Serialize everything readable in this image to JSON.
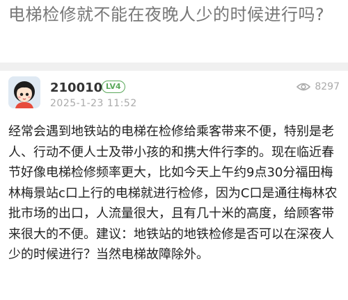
{
  "post": {
    "title": "电梯检修就不能在夜晚人少的时候进行吗?",
    "author": {
      "name": "210010",
      "level": "LV4",
      "avatar_icon": "cartoon-girl-avatar"
    },
    "timestamp": "2025-1-23 11:52",
    "views": "8297",
    "body": "经常会遇到地铁站的电梯在检修给乘客带来不便，特别是老人、行动不便人士及带小孩的和携大件行李的。现在临近春节好像电梯检修频率更大，比如今天上午约9点30分福田梅林梅景站c口上行的电梯就进行检修，因为C口是通往梅林农批市场的出口，人流量很大，且有几十米的高度，给顾客带来很大的不便。建议：地铁站的地铁检修是否可以在深夜人少的时候进行？当然电梯故障除外。"
  },
  "colors": {
    "level_badge": "#5aa85a",
    "meta_text": "#aaaaaa",
    "title_text": "#777777"
  }
}
